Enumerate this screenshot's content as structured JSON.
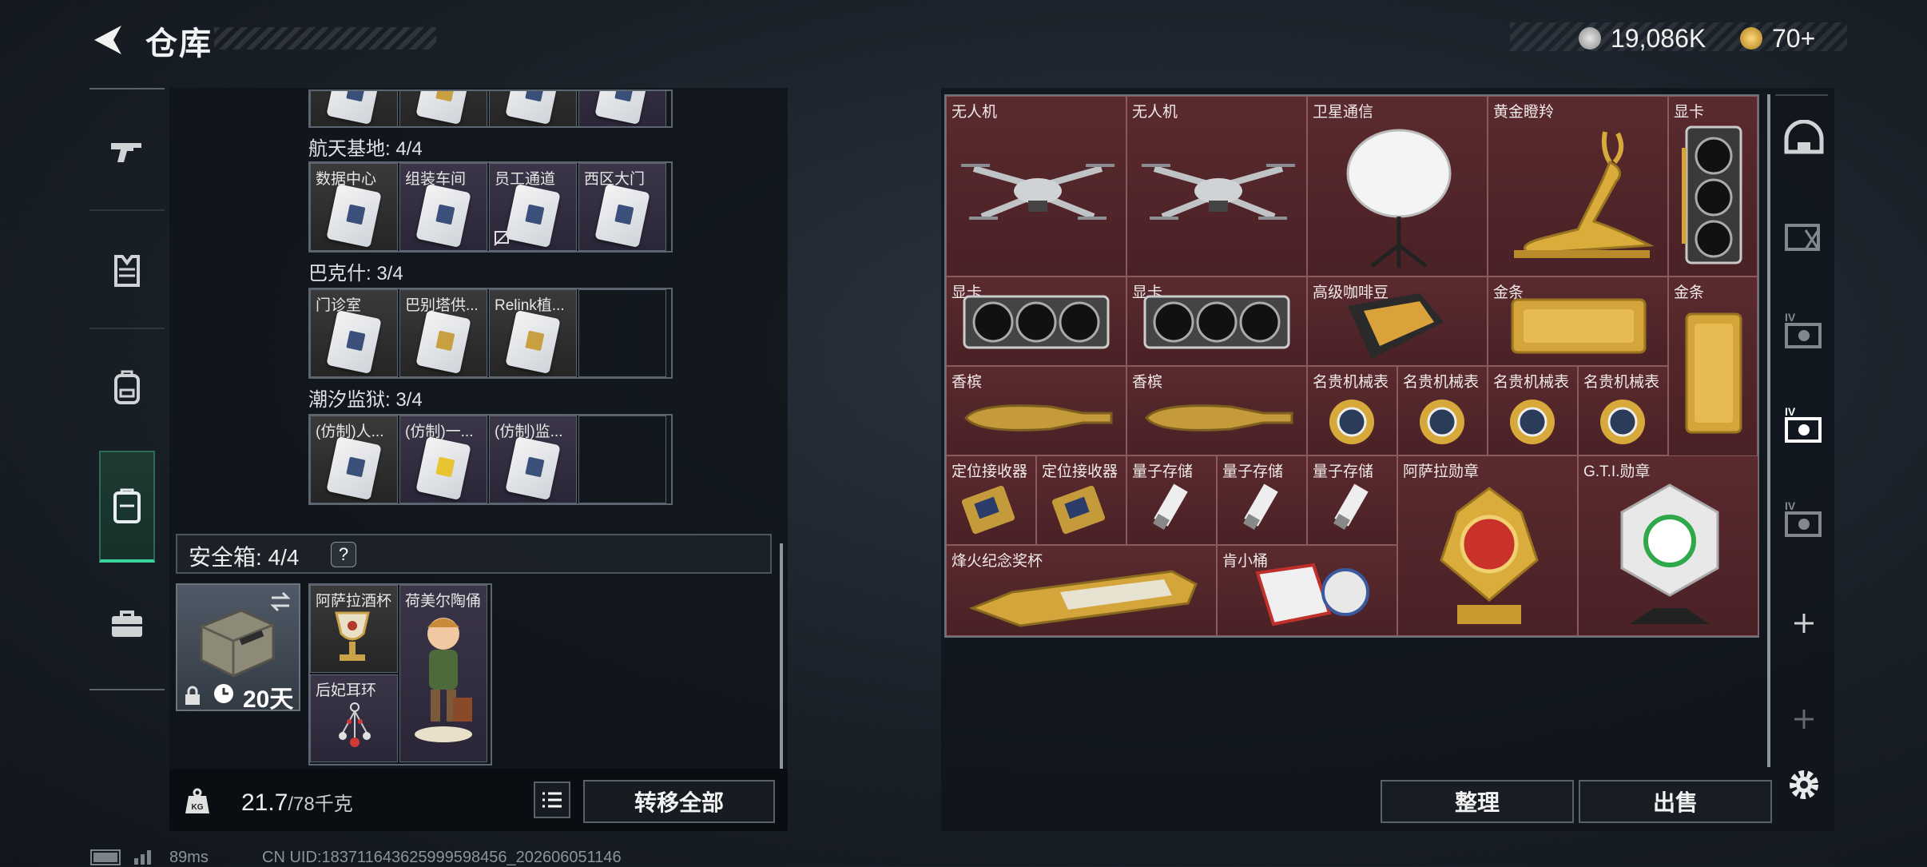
{
  "header": {
    "title": "仓库"
  },
  "currency": {
    "money": "19,086K",
    "tickets": "70+"
  },
  "left_nav": [
    "weapon-tab",
    "armor-tab",
    "backpack-tab",
    "keys-tab",
    "case-tab"
  ],
  "key_groups": [
    {
      "label": "航天基地: 4/4",
      "items": [
        "数据中心",
        "组装车间",
        "员工通道",
        "西区大门"
      ]
    },
    {
      "label": "巴克什: 3/4",
      "items": [
        "门诊室",
        "巴别塔供...",
        "Relink植..."
      ]
    },
    {
      "label": "潮汐监狱: 3/4",
      "items": [
        "(仿制)人...",
        "(仿制)一...",
        "(仿制)监..."
      ]
    }
  ],
  "safe_box": {
    "title": "安全箱: 4/4",
    "help": "?",
    "days": "20天",
    "items": [
      "阿萨拉酒杯",
      "荷美尔陶俑",
      "后妃耳环"
    ]
  },
  "footer": {
    "weight": "21.7",
    "weight_max": "/78千克",
    "transfer_all": "转移全部"
  },
  "stash": {
    "items": [
      "无人机",
      "无人机",
      "卫星通信",
      "黄金瞪羚",
      "显卡",
      "显卡",
      "显卡",
      "高级咖啡豆",
      "金条",
      "金条",
      "香槟",
      "香槟",
      "名贵机械表",
      "名贵机械表",
      "名贵机械表",
      "名贵机械表",
      "定位接收器",
      "定位接收器",
      "量子存储",
      "量子存储",
      "量子存储",
      "阿萨拉勋章",
      "G.T.I.勋章",
      "烽火纪念奖杯",
      "肯小桶"
    ],
    "sort_label": "整理",
    "sell_label": "出售"
  },
  "status_bar": {
    "ping": "89ms",
    "uid": "CN UID:1837116436259995984​56_202606051146"
  }
}
